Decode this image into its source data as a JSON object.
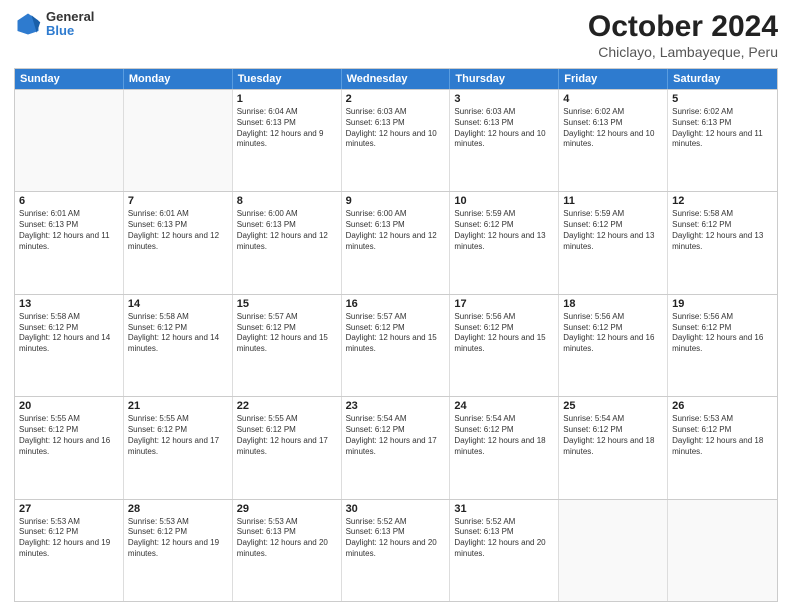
{
  "logo": {
    "general": "General",
    "blue": "Blue"
  },
  "title": "October 2024",
  "subtitle": "Chiclayo, Lambayeque, Peru",
  "header_days": [
    "Sunday",
    "Monday",
    "Tuesday",
    "Wednesday",
    "Thursday",
    "Friday",
    "Saturday"
  ],
  "weeks": [
    [
      {
        "day": "",
        "text": ""
      },
      {
        "day": "",
        "text": ""
      },
      {
        "day": "1",
        "text": "Sunrise: 6:04 AM\nSunset: 6:13 PM\nDaylight: 12 hours and 9 minutes."
      },
      {
        "day": "2",
        "text": "Sunrise: 6:03 AM\nSunset: 6:13 PM\nDaylight: 12 hours and 10 minutes."
      },
      {
        "day": "3",
        "text": "Sunrise: 6:03 AM\nSunset: 6:13 PM\nDaylight: 12 hours and 10 minutes."
      },
      {
        "day": "4",
        "text": "Sunrise: 6:02 AM\nSunset: 6:13 PM\nDaylight: 12 hours and 10 minutes."
      },
      {
        "day": "5",
        "text": "Sunrise: 6:02 AM\nSunset: 6:13 PM\nDaylight: 12 hours and 11 minutes."
      }
    ],
    [
      {
        "day": "6",
        "text": "Sunrise: 6:01 AM\nSunset: 6:13 PM\nDaylight: 12 hours and 11 minutes."
      },
      {
        "day": "7",
        "text": "Sunrise: 6:01 AM\nSunset: 6:13 PM\nDaylight: 12 hours and 12 minutes."
      },
      {
        "day": "8",
        "text": "Sunrise: 6:00 AM\nSunset: 6:13 PM\nDaylight: 12 hours and 12 minutes."
      },
      {
        "day": "9",
        "text": "Sunrise: 6:00 AM\nSunset: 6:13 PM\nDaylight: 12 hours and 12 minutes."
      },
      {
        "day": "10",
        "text": "Sunrise: 5:59 AM\nSunset: 6:12 PM\nDaylight: 12 hours and 13 minutes."
      },
      {
        "day": "11",
        "text": "Sunrise: 5:59 AM\nSunset: 6:12 PM\nDaylight: 12 hours and 13 minutes."
      },
      {
        "day": "12",
        "text": "Sunrise: 5:58 AM\nSunset: 6:12 PM\nDaylight: 12 hours and 13 minutes."
      }
    ],
    [
      {
        "day": "13",
        "text": "Sunrise: 5:58 AM\nSunset: 6:12 PM\nDaylight: 12 hours and 14 minutes."
      },
      {
        "day": "14",
        "text": "Sunrise: 5:58 AM\nSunset: 6:12 PM\nDaylight: 12 hours and 14 minutes."
      },
      {
        "day": "15",
        "text": "Sunrise: 5:57 AM\nSunset: 6:12 PM\nDaylight: 12 hours and 15 minutes."
      },
      {
        "day": "16",
        "text": "Sunrise: 5:57 AM\nSunset: 6:12 PM\nDaylight: 12 hours and 15 minutes."
      },
      {
        "day": "17",
        "text": "Sunrise: 5:56 AM\nSunset: 6:12 PM\nDaylight: 12 hours and 15 minutes."
      },
      {
        "day": "18",
        "text": "Sunrise: 5:56 AM\nSunset: 6:12 PM\nDaylight: 12 hours and 16 minutes."
      },
      {
        "day": "19",
        "text": "Sunrise: 5:56 AM\nSunset: 6:12 PM\nDaylight: 12 hours and 16 minutes."
      }
    ],
    [
      {
        "day": "20",
        "text": "Sunrise: 5:55 AM\nSunset: 6:12 PM\nDaylight: 12 hours and 16 minutes."
      },
      {
        "day": "21",
        "text": "Sunrise: 5:55 AM\nSunset: 6:12 PM\nDaylight: 12 hours and 17 minutes."
      },
      {
        "day": "22",
        "text": "Sunrise: 5:55 AM\nSunset: 6:12 PM\nDaylight: 12 hours and 17 minutes."
      },
      {
        "day": "23",
        "text": "Sunrise: 5:54 AM\nSunset: 6:12 PM\nDaylight: 12 hours and 17 minutes."
      },
      {
        "day": "24",
        "text": "Sunrise: 5:54 AM\nSunset: 6:12 PM\nDaylight: 12 hours and 18 minutes."
      },
      {
        "day": "25",
        "text": "Sunrise: 5:54 AM\nSunset: 6:12 PM\nDaylight: 12 hours and 18 minutes."
      },
      {
        "day": "26",
        "text": "Sunrise: 5:53 AM\nSunset: 6:12 PM\nDaylight: 12 hours and 18 minutes."
      }
    ],
    [
      {
        "day": "27",
        "text": "Sunrise: 5:53 AM\nSunset: 6:12 PM\nDaylight: 12 hours and 19 minutes."
      },
      {
        "day": "28",
        "text": "Sunrise: 5:53 AM\nSunset: 6:12 PM\nDaylight: 12 hours and 19 minutes."
      },
      {
        "day": "29",
        "text": "Sunrise: 5:53 AM\nSunset: 6:13 PM\nDaylight: 12 hours and 20 minutes."
      },
      {
        "day": "30",
        "text": "Sunrise: 5:52 AM\nSunset: 6:13 PM\nDaylight: 12 hours and 20 minutes."
      },
      {
        "day": "31",
        "text": "Sunrise: 5:52 AM\nSunset: 6:13 PM\nDaylight: 12 hours and 20 minutes."
      },
      {
        "day": "",
        "text": ""
      },
      {
        "day": "",
        "text": ""
      }
    ]
  ]
}
